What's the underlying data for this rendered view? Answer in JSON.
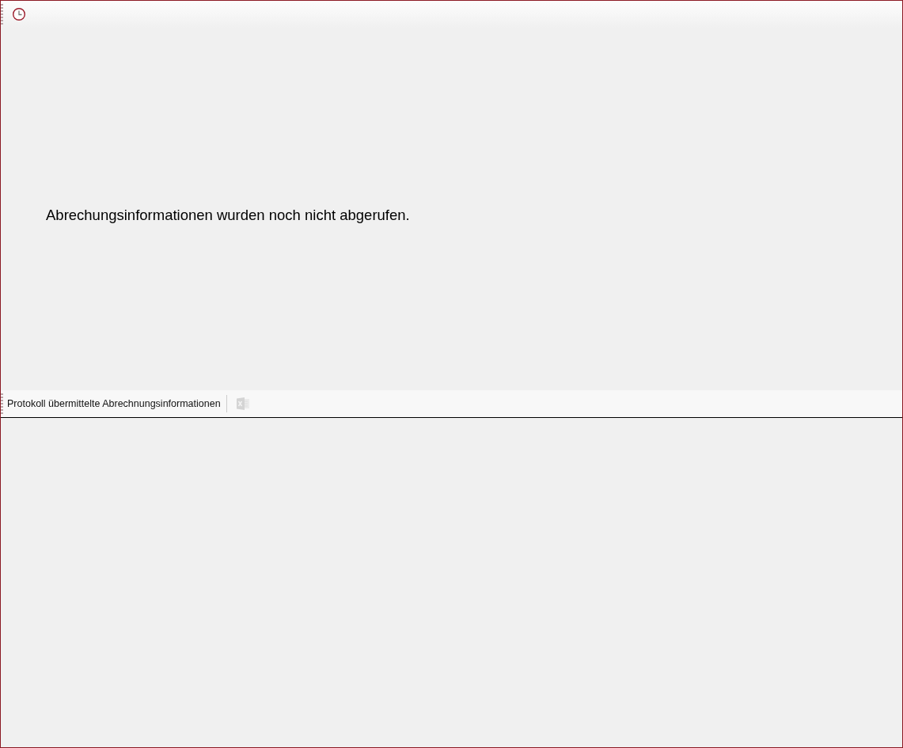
{
  "top_toolbar": {
    "history_button": {
      "disabled": false
    }
  },
  "message": "Abrechungsinformationen wurden noch nicht abgerufen.",
  "log_toolbar": {
    "title": "Protokoll übermittelte Abrechnungsinformationen",
    "export_button": {
      "disabled": true
    }
  }
}
